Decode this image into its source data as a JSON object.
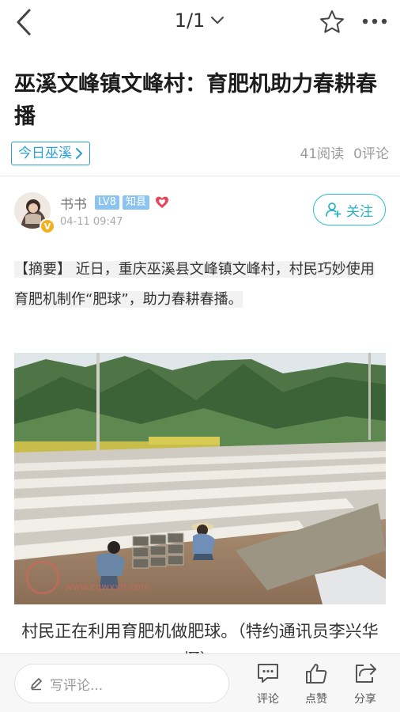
{
  "header": {
    "pager": "1/1",
    "back_icon": "chevron-left-icon",
    "favorite_icon": "star-outline-icon",
    "more_icon": "more-dots-icon"
  },
  "article": {
    "title": "巫溪文峰镇文峰村：育肥机助力春耕春播",
    "source": "今日巫溪",
    "reads": "41阅读",
    "comments": "0评论"
  },
  "author": {
    "name": "书书",
    "level": "LV8",
    "role": "知县",
    "time": "04-11 09:47",
    "verified_badge": "V",
    "follow_label": "关注"
  },
  "summary": {
    "label": "【摘要】",
    "text": "近日，重庆巫溪县文峰镇文峰村，村民巧妙使用育肥机制作“肥球”，助力春耕春播。"
  },
  "photo": {
    "watermark": "www.cqwxxh.com"
  },
  "caption": "村民正在利用育肥机做肥球。（特约通讯员李兴华 摄）",
  "bottom_bar": {
    "comment_placeholder": "写评论...",
    "comment_label": "评论",
    "like_label": "点赞",
    "share_label": "分享"
  },
  "colors": {
    "accent_blue": "#2a9fd8",
    "follow_teal": "#2ab4c0",
    "badge_blue": "#8cc4f0",
    "badge_gold": "#f2b01e"
  }
}
